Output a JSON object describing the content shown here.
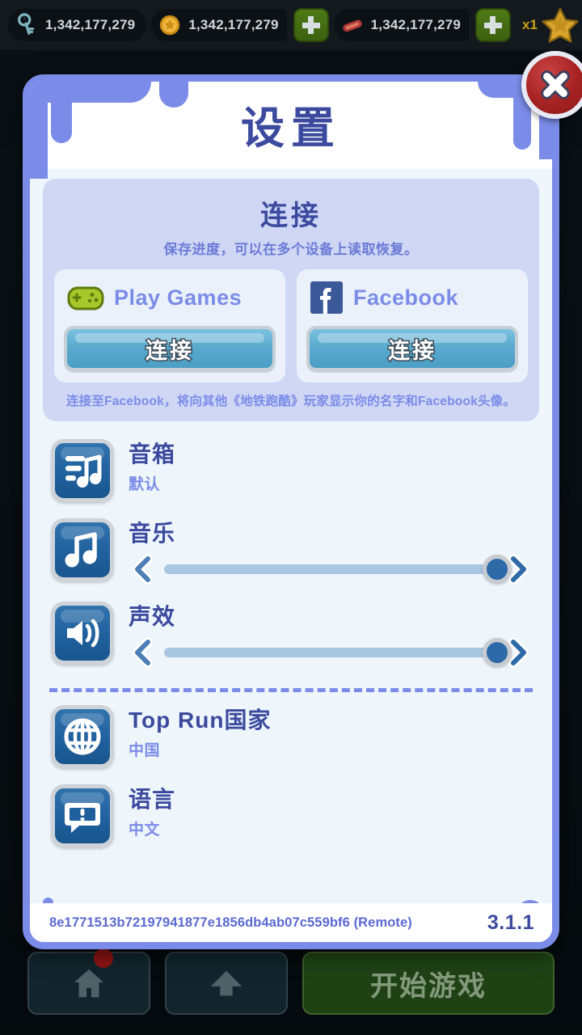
{
  "hud": {
    "key_icon": "key-icon",
    "key_count": "1,342,177,279",
    "coin_icon": "coin-icon",
    "coin_count": "1,342,177,279",
    "coin_add_label": "+",
    "hoverboard_icon": "hoverboard-icon",
    "hoverboard_count": "1,342,177,279",
    "hoverboard_add_label": "+",
    "multiplier_label": "x1",
    "star_icon": "star-icon",
    "settings_icon": "gear-icon"
  },
  "dialog": {
    "title": "设置",
    "close_label": "close-icon",
    "connect": {
      "heading": "连接",
      "subtitle": "保存进度，可以在多个设备上读取恢复。",
      "cards": [
        {
          "icon": "gamepad-icon",
          "name": "Play Games",
          "button_label": "连接"
        },
        {
          "icon": "facebook-icon",
          "name": "Facebook",
          "button_label": "连接"
        }
      ],
      "note": "连接至Facebook，将向其他《地铁跑酷》玩家显示你的名字和Facebook头像。"
    },
    "rows": [
      {
        "icon": "speaker-playlist-icon",
        "label": "音箱",
        "value": "默认"
      },
      {
        "icon": "music-note-icon",
        "label": "音乐",
        "slider_percent": 100
      },
      {
        "icon": "sound-volume-icon",
        "label": "声效",
        "slider_percent": 100
      },
      {
        "icon": "globe-icon",
        "label": "Top Run国家",
        "value": "中国"
      },
      {
        "icon": "speech-bubble-icon",
        "label": "语言",
        "value": "中文"
      }
    ],
    "footer": {
      "build_hash": "8e1771513b72197941877e1856db4ab07c559bf6 (Remote)",
      "version": "3.1.1"
    }
  },
  "bottom_nav": {
    "home_label": "home-icon",
    "upgrade_label": "upgrade-chevron-icon",
    "play_label": "开始游戏"
  },
  "colors": {
    "dialog_border": "#7b8ce8",
    "title_blue": "#3b4a9e",
    "accent_blue": "#7b8ce8",
    "panel_lavender": "#cfd7f5",
    "body_bg": "#eef6fc",
    "button_blue": "#58a9cd",
    "close_red": "#a62222",
    "icon_blue": "#1e5f9c",
    "play_green": "#3c6110"
  }
}
